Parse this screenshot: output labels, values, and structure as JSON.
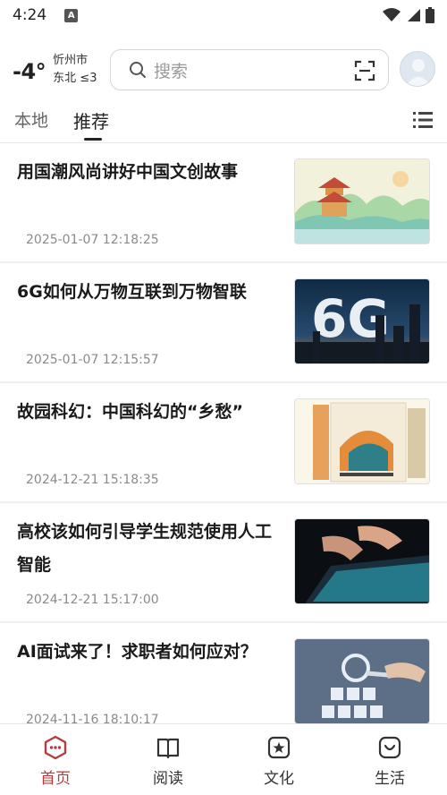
{
  "status_bar": {
    "time": "4:24"
  },
  "header": {
    "temperature": "-4°",
    "city": "忻州市",
    "wind": "东北 ≤3",
    "search_placeholder": "搜索"
  },
  "tabs": [
    {
      "label": "本地"
    },
    {
      "label": "推荐"
    }
  ],
  "articles": [
    {
      "title": "用国潮风尚讲好中国文创故事",
      "time": "2025-01-07 12:18:25"
    },
    {
      "title": "6G如何从万物互联到万物智联",
      "time": "2025-01-07 12:15:57"
    },
    {
      "title": "故园科幻：中国科幻的“乡愁”",
      "time": "2024-12-21 15:18:35"
    },
    {
      "title": "高校该如何引导学生规范使用人工智能",
      "time": "2024-12-21 15:17:00"
    },
    {
      "title": "AI面试来了！求职者如何应对？",
      "time": "2024-11-16 18:10:17"
    }
  ],
  "thumb_text": {
    "six_g": "6G"
  },
  "bottom_nav": [
    {
      "label": "首页"
    },
    {
      "label": "阅读"
    },
    {
      "label": "文化"
    },
    {
      "label": "生活"
    }
  ],
  "colors": {
    "accent": "#b43c3c",
    "text": "#1a1a1a",
    "muted": "#8a8a8a"
  }
}
